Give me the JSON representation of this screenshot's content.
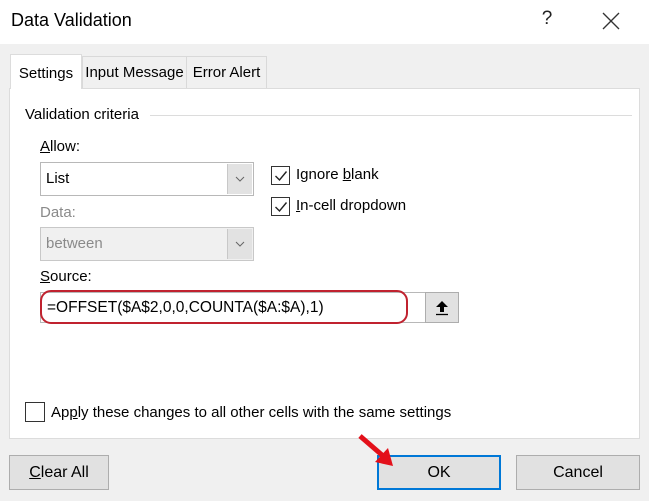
{
  "window": {
    "title": "Data Validation",
    "help_label": "?",
    "close_icon": "close-icon"
  },
  "tabs": [
    {
      "label": "Settings",
      "active": true
    },
    {
      "label": "Input Message",
      "active": false
    },
    {
      "label": "Error Alert",
      "active": false
    }
  ],
  "settings": {
    "group_label": "Validation criteria",
    "allow": {
      "label_hotkey": "A",
      "label_rest": "llow:",
      "value": "List"
    },
    "data": {
      "label": "Data:",
      "value": "between",
      "disabled": true
    },
    "ignore_blank": {
      "checked": true,
      "label_before": "Ignore ",
      "label_hotkey": "b",
      "label_after": "lank"
    },
    "in_cell_dropdown": {
      "checked": true,
      "label_hotkey": "I",
      "label_rest": "n-cell dropdown"
    },
    "source": {
      "label_hotkey": "S",
      "label_rest": "ource:",
      "value": "=OFFSET($A$2,0,0,COUNTA($A:$A),1)",
      "collapse_icon": "arrow-up-icon"
    },
    "apply_all": {
      "checked": false,
      "label_before": "Ap",
      "label_hotkey": "p",
      "label_after": "ly these changes to all other cells with the same settings"
    }
  },
  "buttons": {
    "clear_all_hotkey": "C",
    "clear_all_rest": "lear All",
    "ok": "OK",
    "cancel": "Cancel"
  },
  "annotations": {
    "highlight_color": "#c0222f",
    "arrow_color": "#e3101a",
    "default_button_border": "#0078d7"
  }
}
